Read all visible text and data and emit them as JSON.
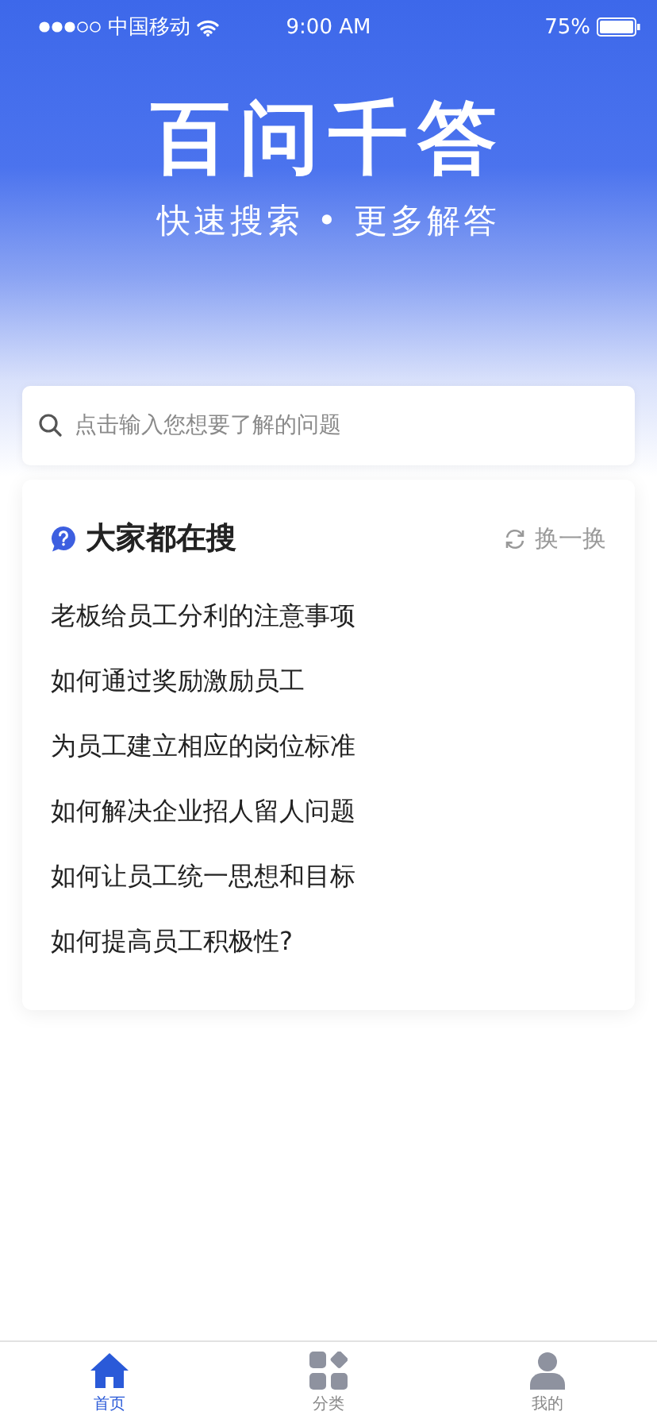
{
  "status_bar": {
    "carrier": "中国移动",
    "time": "9:00 AM",
    "battery": "75%"
  },
  "header": {
    "logo": "百问千答",
    "slogan": "快速搜索 • 更多解答"
  },
  "search": {
    "placeholder": "点击输入您想要了解的问题"
  },
  "hot": {
    "title": "大家都在搜",
    "refresh": "换一换",
    "items": [
      "老板给员工分利的注意事项",
      "如何通过奖励激励员工",
      "为员工建立相应的岗位标准",
      "如何解决企业招人留人问题",
      "如何让员工统一思想和目标",
      "如何提高员工积极性?"
    ]
  },
  "tabs": [
    {
      "label": "首页",
      "kind": "home",
      "selected": true
    },
    {
      "label": "分类",
      "kind": "category",
      "selected": false
    },
    {
      "label": "我的",
      "kind": "profile",
      "selected": false
    }
  ]
}
